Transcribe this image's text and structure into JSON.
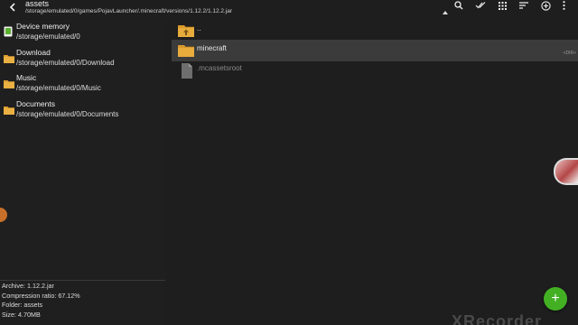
{
  "header": {
    "title": "assets",
    "path": "/storage/emulated/0/games/PojavLauncher/.minecraft/versions/1.12.2/1.12.2.jar",
    "actions": [
      "search-icon",
      "select-all-icon",
      "grid-view-icon",
      "sort-icon",
      "add-circle-icon",
      "more-vert-icon"
    ]
  },
  "places": [
    {
      "name": "Device memory",
      "path": "/storage/emulated/0",
      "icon": "device-memory-icon"
    },
    {
      "name": "Download",
      "path": "/storage/emulated/0/Download",
      "icon": "folder-icon"
    },
    {
      "name": "Music",
      "path": "/storage/emulated/0/Music",
      "icon": "folder-icon"
    },
    {
      "name": "Documents",
      "path": "/storage/emulated/0/Documents",
      "icon": "folder-icon"
    }
  ],
  "info": {
    "archive": "Archive: 1.12.2.jar",
    "compression": "Compression ratio: 67.12%",
    "folder": "Folder: assets",
    "size": "Size: 4.70MB"
  },
  "files": [
    {
      "name": "..",
      "type": "parent-folder"
    },
    {
      "name": "minecraft",
      "type": "folder",
      "tag": "<DIR>",
      "selected": true
    },
    {
      "name": ".mcassetsroot",
      "type": "file"
    }
  ],
  "fab": {
    "label": "+"
  },
  "watermark": "XRecorder",
  "colors": {
    "folder": "#e0a030",
    "fab": "#43b024",
    "selected_row": "#3b3b3b",
    "background": "#1e1e1e"
  }
}
